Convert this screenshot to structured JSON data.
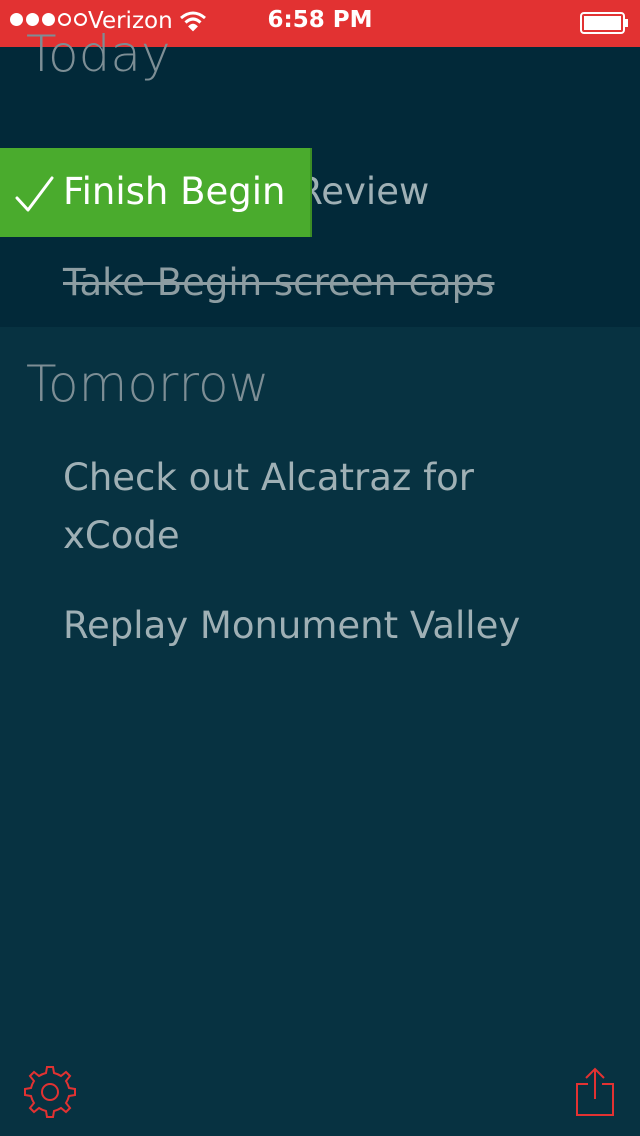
{
  "status_bar": {
    "carrier": "Verizon",
    "time": "6:58 PM",
    "signal_bars_filled": 3,
    "signal_bars_total": 5,
    "background_color": "#e23232",
    "icons": [
      "wifi-icon",
      "battery-icon"
    ]
  },
  "sections": {
    "today": {
      "title": "Today",
      "tasks": [
        {
          "text": "Finish Begin Review",
          "swipe_text": "Finish Begin",
          "completed": false
        },
        {
          "text": "Take Begin screen caps",
          "completed": true
        }
      ]
    },
    "tomorrow": {
      "title": "Tomorrow",
      "tasks": [
        {
          "text": "Check out Alcatraz for xCode",
          "completed": false
        },
        {
          "text": "Replay Monument Valley",
          "completed": false
        }
      ]
    }
  },
  "toolbar": {
    "left_icon": "gear-icon",
    "right_icon": "share-icon"
  },
  "colors": {
    "accent": "#e23232",
    "complete_green": "#4aab2d",
    "today_background": "#022939",
    "tomorrow_background": "#073241"
  }
}
